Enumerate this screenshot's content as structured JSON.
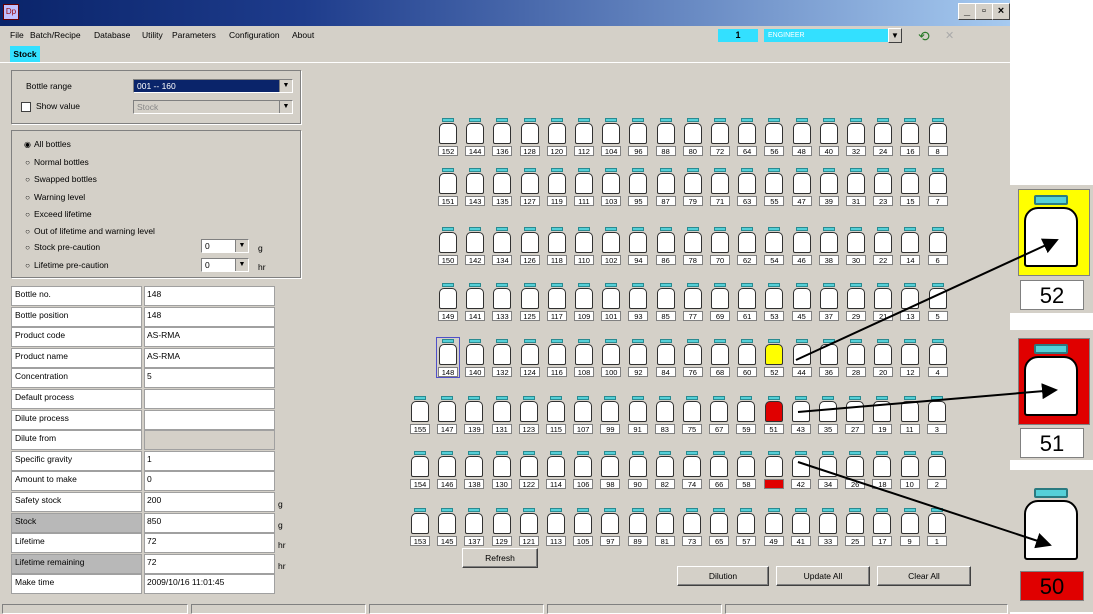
{
  "window": {
    "app_icon": "Dp",
    "min": "_",
    "max": "▫",
    "close": "×"
  },
  "menu": [
    "File",
    "Batch/Recipe",
    "Database",
    "Utility",
    "Parameters",
    "Configuration",
    "About"
  ],
  "user": {
    "number": "1",
    "role": "ENGINEER"
  },
  "tab": "Stock",
  "filters": {
    "bottle_range_label": "Bottle range",
    "bottle_range_value": "001 -- 160",
    "show_value_label": "Show value",
    "show_value_select": "Stock"
  },
  "modes": [
    {
      "label": "All bottles",
      "checked": true
    },
    {
      "label": "Normal bottles",
      "checked": false
    },
    {
      "label": "Swapped bottles",
      "checked": false
    },
    {
      "label": "Warning level",
      "checked": false
    },
    {
      "label": "Exceed lifetime",
      "checked": false
    },
    {
      "label": "Out of lifetime and warning level",
      "checked": false
    },
    {
      "label": "Stock pre-caution",
      "checked": false
    },
    {
      "label": "Lifetime pre-caution",
      "checked": false
    }
  ],
  "precaution": {
    "stock_value": "0",
    "stock_unit": "g",
    "lifetime_value": "0",
    "lifetime_unit": "hr"
  },
  "info": [
    {
      "label": "Bottle no.",
      "value": "148",
      "unit": ""
    },
    {
      "label": "Bottle position",
      "value": "148",
      "unit": ""
    },
    {
      "label": "Product code",
      "value": "AS-RMA",
      "unit": ""
    },
    {
      "label": "Product name",
      "value": "AS-RMA",
      "unit": ""
    },
    {
      "label": "Concentration",
      "value": "5",
      "unit": ""
    },
    {
      "label": "Default process",
      "value": "",
      "unit": ""
    },
    {
      "label": "Dilute process",
      "value": "",
      "unit": ""
    },
    {
      "label": "Dilute from",
      "value": "",
      "unit": ""
    },
    {
      "label": "Specific gravity",
      "value": "1",
      "unit": ""
    },
    {
      "label": "Amount to make",
      "value": "0",
      "unit": ""
    },
    {
      "label": "Safety stock",
      "value": "200",
      "unit": "g"
    },
    {
      "label": "Stock",
      "value": "850",
      "unit": "g"
    },
    {
      "label": "Lifetime",
      "value": "72",
      "unit": "hr"
    },
    {
      "label": "Lifetime remaining",
      "value": "72",
      "unit": "hr"
    },
    {
      "label": "Make time",
      "value": "2009/10/16 11:01:45",
      "unit": ""
    }
  ],
  "bottle_rows": [
    [
      "152",
      "144",
      "136",
      "128",
      "120",
      "112",
      "104",
      "96",
      "88",
      "80",
      "72",
      "64",
      "56",
      "48",
      "40",
      "32",
      "24",
      "16",
      "8"
    ],
    [
      "151",
      "143",
      "135",
      "127",
      "119",
      "111",
      "103",
      "95",
      "87",
      "79",
      "71",
      "63",
      "55",
      "47",
      "39",
      "31",
      "23",
      "15",
      "7"
    ],
    [
      "150",
      "142",
      "134",
      "126",
      "118",
      "110",
      "102",
      "94",
      "86",
      "78",
      "70",
      "62",
      "54",
      "46",
      "38",
      "30",
      "22",
      "14",
      "6"
    ],
    [
      "149",
      "141",
      "133",
      "125",
      "117",
      "109",
      "101",
      "93",
      "85",
      "77",
      "69",
      "61",
      "53",
      "45",
      "37",
      "29",
      "21",
      "13",
      "5"
    ],
    [
      "148",
      "140",
      "132",
      "124",
      "116",
      "108",
      "100",
      "92",
      "84",
      "76",
      "68",
      "60",
      "52",
      "44",
      "36",
      "28",
      "20",
      "12",
      "4"
    ],
    [
      "155",
      "147",
      "139",
      "131",
      "123",
      "115",
      "107",
      "99",
      "91",
      "83",
      "75",
      "67",
      "59",
      "51",
      "43",
      "35",
      "27",
      "19",
      "11",
      "3"
    ],
    [
      "154",
      "146",
      "138",
      "130",
      "122",
      "114",
      "106",
      "98",
      "90",
      "82",
      "74",
      "66",
      "58",
      "50",
      "42",
      "34",
      "26",
      "18",
      "10",
      "2"
    ],
    [
      "153",
      "145",
      "137",
      "129",
      "121",
      "113",
      "105",
      "97",
      "89",
      "81",
      "73",
      "65",
      "57",
      "49",
      "41",
      "33",
      "25",
      "17",
      "9",
      "1"
    ]
  ],
  "bottle_status": {
    "52": "yellow",
    "51": "red",
    "50": "number-red",
    "148": "selected"
  },
  "buttons": {
    "refresh": "Refresh",
    "dilution": "Dilution",
    "update_all": "Update All",
    "clear_all": "Clear All"
  },
  "zoom": [
    {
      "number": "52",
      "status": "yellow"
    },
    {
      "number": "51",
      "status": "red"
    },
    {
      "number": "50",
      "status": "number-red"
    }
  ],
  "colors": {
    "cyan": "#33e0ff",
    "yellow": "#ffff00",
    "red": "#e00000",
    "cap": "#55d0d8"
  }
}
